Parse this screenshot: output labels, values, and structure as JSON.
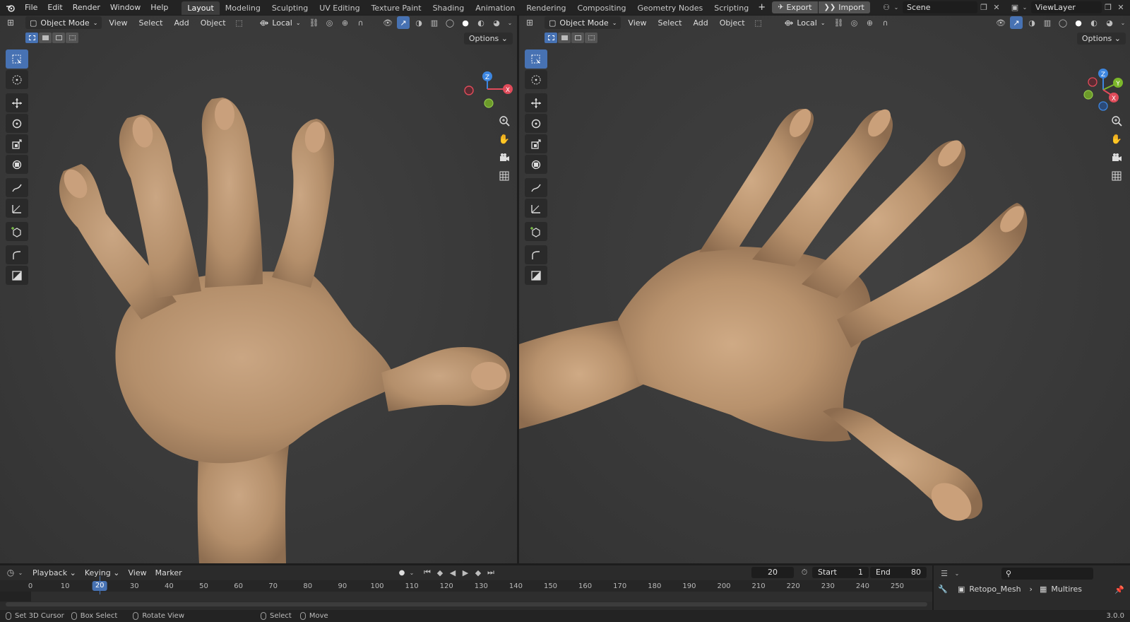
{
  "menu": {
    "file": "File",
    "edit": "Edit",
    "render": "Render",
    "window": "Window",
    "help": "Help"
  },
  "workspaces": [
    "Layout",
    "Modeling",
    "Sculpting",
    "UV Editing",
    "Texture Paint",
    "Shading",
    "Animation",
    "Rendering",
    "Compositing",
    "Geometry Nodes",
    "Scripting"
  ],
  "active_workspace": "Layout",
  "addon_buttons": {
    "export": "Export",
    "import": "Import"
  },
  "scene": {
    "name": "Scene"
  },
  "view_layer": {
    "name": "ViewLayer"
  },
  "viewport_left": {
    "mode": "Object Mode",
    "view": "View",
    "select": "Select",
    "add": "Add",
    "object": "Object",
    "orientation": "Local",
    "options": "Options"
  },
  "viewport_right": {
    "mode": "Object Mode",
    "view": "View",
    "select": "Select",
    "add": "Add",
    "object": "Object",
    "orientation": "Local",
    "options": "Options"
  },
  "gizmo_axes": {
    "x": "X",
    "y": "Y",
    "z": "Z"
  },
  "timeline": {
    "playback": "Playback",
    "keying": "Keying",
    "view": "View",
    "marker": "Marker",
    "current_frame": "20",
    "start_label": "Start",
    "start": "1",
    "end_label": "End",
    "end": "80",
    "ticks": [
      "0",
      "10",
      "20",
      "30",
      "40",
      "50",
      "60",
      "70",
      "80",
      "90",
      "100",
      "110",
      "120",
      "130",
      "140",
      "150",
      "160",
      "170",
      "180",
      "190",
      "200",
      "210",
      "220",
      "230",
      "240",
      "250"
    ]
  },
  "outliner": {
    "object": "Retopo_Mesh",
    "modifier": "Multires",
    "search_placeholder": ""
  },
  "status": {
    "cursor": "Set 3D Cursor",
    "box": "Box Select",
    "rotate": "Rotate View",
    "select": "Select",
    "move": "Move",
    "version": "3.0.0"
  },
  "colors": {
    "accent": "#4772b3",
    "skin": "#b99570",
    "axis_x": "#e04b5a",
    "axis_y": "#7cb82a",
    "axis_z": "#3d86e0"
  }
}
